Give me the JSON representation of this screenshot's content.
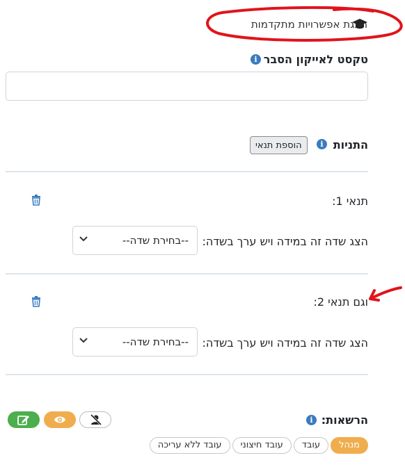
{
  "advanced": {
    "label": "הצגת אפשרויות מתקדמות",
    "icon": "graduation-cap-icon"
  },
  "tooltip_text": {
    "label": "טקסט לאייקון הסבר",
    "value": ""
  },
  "conditions": {
    "title": "התניות",
    "add_button": "הוספת תנאי",
    "items": [
      {
        "title": "תנאי 1:",
        "prompt": "הצג שדה זה במידה ויש ערך בשדה:",
        "select_value": "--בחירת שדה--"
      },
      {
        "title": "וגם תנאי 2:",
        "prompt": "הצג שדה זה במידה ויש ערך בשדה:",
        "select_value": "--בחירת שדה--"
      }
    ]
  },
  "permissions": {
    "title": "הרשאות:",
    "roles": [
      "מנהל",
      "עובד",
      "עובד חיצוני",
      "עובד ללא עריכה"
    ],
    "active_role": "מנהל",
    "buttons": [
      "hide-user-icon",
      "eye-icon",
      "edit-icon"
    ]
  },
  "colors": {
    "accent_blue": "#3b7bbf",
    "active_orange": "#f0ad4e",
    "edit_green": "#4cae4c",
    "annotation_red": "#e0141b"
  }
}
